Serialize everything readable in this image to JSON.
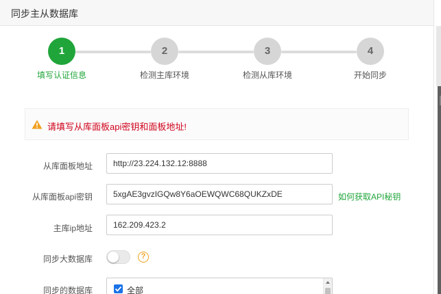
{
  "window": {
    "title": "同步主从数据库"
  },
  "steps": [
    {
      "number": "1",
      "label": "填写认证信息",
      "active": true
    },
    {
      "number": "2",
      "label": "检测主库环境",
      "active": false
    },
    {
      "number": "3",
      "label": "检测从库环境",
      "active": false
    },
    {
      "number": "4",
      "label": "开始同步",
      "active": false
    }
  ],
  "alert": {
    "icon": "warning-icon",
    "message": "请填写从库面板api密钥和面板地址!",
    "color": "#d0021b"
  },
  "form": {
    "slave_panel_url": {
      "label": "从库面板地址",
      "value": "http://23.224.132.12:8888"
    },
    "slave_api_key": {
      "label": "从库面板api密钥",
      "value": "5xgAE3gvzIGQw8Y6aOEWQWC68QUKZxDE"
    },
    "api_help_link": "如何获取API秘钥",
    "master_ip": {
      "label": "主库ip地址",
      "value": "162.209.423.2"
    },
    "sync_large_db": {
      "label": "同步大数据库",
      "enabled": false,
      "help_icon": "question-icon",
      "help_glyph": "?"
    },
    "sync_databases": {
      "label": "同步的数据库",
      "options": [
        {
          "label": "全部",
          "checked": true
        }
      ]
    }
  },
  "colors": {
    "accent": "#20a53a",
    "inactive_step": "#d6d6d6",
    "warning": "#f0a020",
    "checkbox": "#1a73e8"
  }
}
